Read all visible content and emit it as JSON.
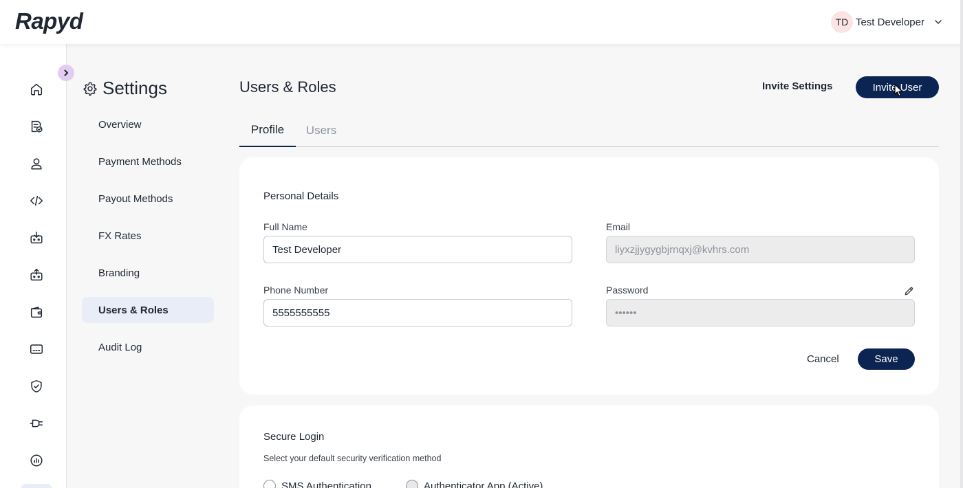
{
  "header": {
    "logo": "Rapyd",
    "user_initials": "TD",
    "user_name": "Test Developer"
  },
  "rail": {
    "icons": [
      "home-icon",
      "document-check-icon",
      "user-icon",
      "code-icon",
      "payout-in-icon",
      "payout-out-icon",
      "wallet-icon",
      "card-icon",
      "shield-check-icon",
      "plug-icon",
      "report-chart-icon"
    ]
  },
  "sidebar": {
    "title": "Settings",
    "items": [
      {
        "label": "Overview"
      },
      {
        "label": "Payment Methods"
      },
      {
        "label": "Payout Methods"
      },
      {
        "label": "FX Rates"
      },
      {
        "label": "Branding"
      },
      {
        "label": "Users & Roles",
        "active": true
      },
      {
        "label": "Audit Log"
      }
    ]
  },
  "main": {
    "title": "Users & Roles",
    "invite_settings_label": "Invite Settings",
    "invite_user_label": "Invite User",
    "tabs": [
      {
        "label": "Profile",
        "active": true
      },
      {
        "label": "Users"
      }
    ]
  },
  "personal": {
    "title": "Personal Details",
    "full_name_label": "Full Name",
    "full_name_value": "Test Developer",
    "email_label": "Email",
    "email_value": "liyxzjjygygbjrnqxj@kvhrs.com",
    "phone_label": "Phone Number",
    "phone_value": "5555555555",
    "password_label": "Password",
    "password_value": "••••••",
    "cancel_label": "Cancel",
    "save_label": "Save"
  },
  "secure": {
    "title": "Secure Login",
    "subtitle": "Select your default security verification method",
    "options": [
      {
        "label": "SMS Authentication"
      },
      {
        "label": "Authenticator App (Active)"
      }
    ]
  },
  "colors": {
    "primary": "#0c2452",
    "active_nav_bg": "#e8edf7",
    "avatar_bg": "#fde4e4",
    "collapse_bg": "#e2cdf0"
  }
}
